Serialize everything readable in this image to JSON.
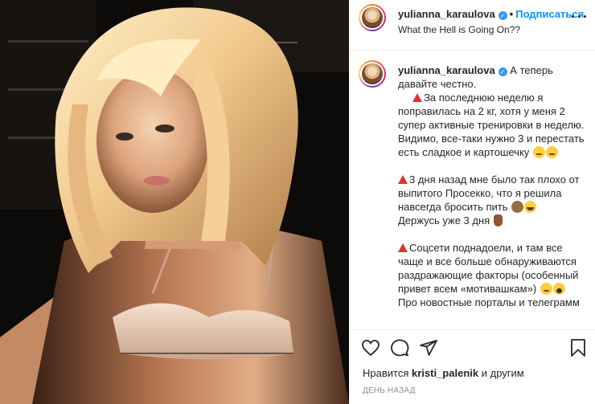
{
  "post": {
    "username": "yulianna_karaulova",
    "verified_badge": "✓",
    "dot": "•",
    "follow_label": "Подписаться",
    "location": "What the Hell is Going On??"
  },
  "caption": {
    "username": "yulianna_karaulova",
    "intro": "А теперь давайте честно.",
    "p1": "За последнюю неделю я поправилась на 2 кг, хотя у меня 2 супер активные тренировки в неделю. Видимо, все-таки нужно 3 и перестать есть сладкое и картошечку",
    "p2a": "3 дня назад мне было так плохо от выпитого Просекко, что я решила навсегда бросить пить",
    "p2b": "Держусь уже 3 дня",
    "p3a": "Соцсети поднадоели, и там все чаще и все больше обнаруживаются раздражающие факторы (особенный привет всем «мотивашкам»)",
    "p3b": "Про новостные порталы и телеграмм"
  },
  "likes": {
    "prefix": "Нравится",
    "user": "kristi_palenik",
    "suffix": "и другим"
  },
  "timestamp": "День назад",
  "icons": {
    "like": "heart-icon",
    "comment": "comment-icon",
    "share": "paper-plane-icon",
    "save": "bookmark-icon",
    "more": "more-dots-icon",
    "warning": "red-triangle-icon"
  },
  "colors": {
    "follow_blue": "#0095f6",
    "verified_blue": "#3897f0",
    "warning_red": "#e0302a",
    "muted": "#8e8e8e"
  }
}
